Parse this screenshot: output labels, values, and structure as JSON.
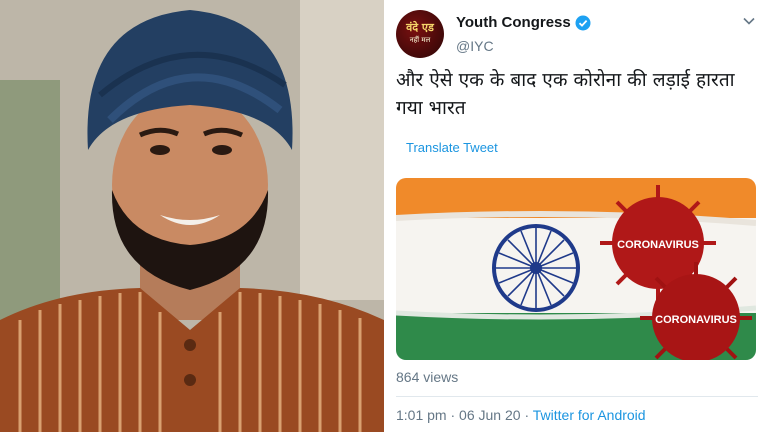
{
  "tweet": {
    "display_name": "Youth Congress",
    "handle": "@IYC",
    "avatar_text": "वंदे एड",
    "avatar_sub": "नहीं मल",
    "text": "और ऐसे एक के बाद एक कोरोना की लड़ाई हारता गया भारत",
    "translate_label": "Translate Tweet",
    "views": "864 views",
    "time": "1:01 pm",
    "date": "06 Jun 20",
    "separator": "·",
    "source": "Twitter for Android"
  },
  "media": {
    "virus_label_1": "CORONAVIRUS",
    "virus_label_2": "CORONAVIRUS"
  },
  "colors": {
    "saffron": "#f08a2a",
    "green": "#2f8a4a",
    "chakra": "#1f3a8a",
    "virus": "#b01818",
    "link": "#1b95e0"
  }
}
